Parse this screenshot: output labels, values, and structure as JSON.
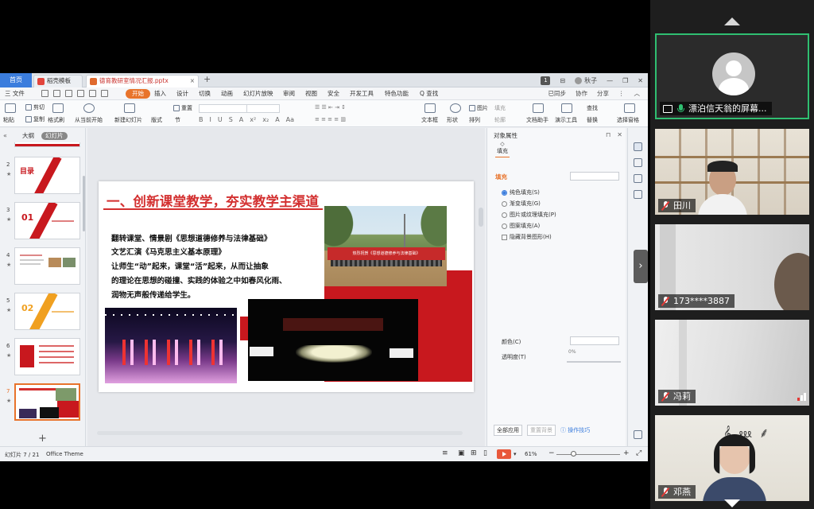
{
  "ppt": {
    "tabs": {
      "home": "首页",
      "template": "稻壳模板",
      "file": "德育教研室情况汇报.pptx"
    },
    "window": {
      "page_count_badge": "1",
      "user": "秋子"
    },
    "menu": {
      "file": "三 文件",
      "items": [
        "开始",
        "插入",
        "设计",
        "切换",
        "动画",
        "幻灯片放映",
        "审阅",
        "视图",
        "安全",
        "开发工具",
        "特色功能",
        "Q 查找"
      ],
      "right": [
        "已同步",
        "协作",
        "分享"
      ]
    },
    "ribbon": {
      "paste": "粘贴",
      "cut": "剪切",
      "copy": "复制",
      "format_painter": "格式刷",
      "from_current": "从当前开始",
      "new_slide": "新建幻灯片",
      "layout": "版式",
      "section": "节",
      "reset": "重置",
      "textbox": "文本框",
      "shape": "形状",
      "arrange": "排列",
      "outline": "轮廓",
      "picture": "图片",
      "fill": "填充",
      "doc_assistant": "文档助手",
      "presenter_tools": "演示工具",
      "find": "查找",
      "replace": "替换",
      "select_pane": "选择窗格",
      "format_buttons": [
        "B",
        "I",
        "U",
        "S",
        "A",
        "x²",
        "x₂",
        "A",
        "Aa"
      ]
    },
    "left_pane": {
      "tab_outline": "大纲",
      "tab_slides": "幻灯片",
      "thumb_numbers": [
        "2",
        "3",
        "4",
        "5",
        "6",
        "7"
      ],
      "thumb2_title": "目录",
      "thumb3_num": "01",
      "thumb5_num": "02",
      "add_symbol": "+"
    },
    "slide": {
      "title": "一、创新课堂教学，夯实教学主渠道",
      "lines": [
        "翻转课堂、情景剧《思想道德修养与法律基础》",
        "文艺汇演《马克思主义基本原理》",
        "让师生“动”起来，课堂“活”起来，从而让抽象",
        "的理论在思想的碰撞、实践的体验之中如春风化雨、",
        "润物无声般传递给学生。"
      ],
      "banner_text": "热烈祝贺《思想道德修养与法律基础》"
    },
    "prop_panel": {
      "header": "对象属性",
      "fill_tab": "填充",
      "section_fill": "填充",
      "options": [
        "纯色填充(S)",
        "渐变填充(G)",
        "图片或纹理填充(P)",
        "图案填充(A)"
      ],
      "hide_bg": "隐藏背景图形(H)",
      "color_label": "颜色(C)",
      "transparency_label": "透明度(T)",
      "transparency_value": "0%",
      "apply_all": "全部应用",
      "reset_bg": "重置背景",
      "tips": "操作技巧"
    },
    "status": {
      "slide_info": "幻灯片 7 / 21",
      "theme": "Office Theme",
      "zoom": "61%"
    }
  },
  "participants": [
    {
      "name": "漂泊信天翁的屏幕...",
      "mic": "on",
      "sharing": true
    },
    {
      "name": "田川",
      "mic": "off"
    },
    {
      "name": "173****3887",
      "mic": "off"
    },
    {
      "name": "冯莉",
      "mic": "off"
    },
    {
      "name": "邓燕",
      "mic": "off"
    }
  ],
  "colors": {
    "accent_orange": "#e8732b",
    "slide_red": "#d32f2f",
    "active_green": "#2fbf71",
    "wps_blue": "#3b7ddd"
  }
}
